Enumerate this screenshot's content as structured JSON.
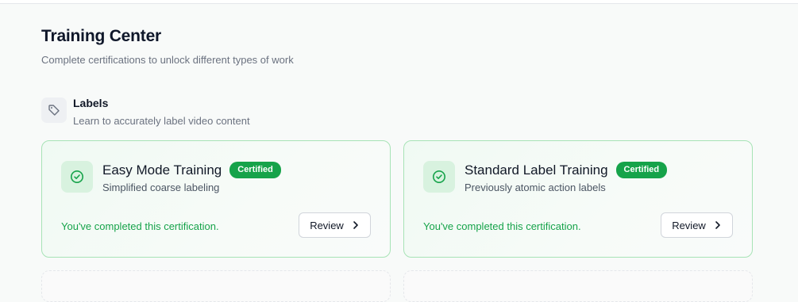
{
  "header": {
    "title": "Training Center",
    "subtitle": "Complete certifications to unlock different types of work"
  },
  "section": {
    "icon": "tag-icon",
    "title": "Labels",
    "subtitle": "Learn to accurately label video content"
  },
  "cards": [
    {
      "icon": "check-circle-icon",
      "title": "Easy Mode Training",
      "badge": "Certified",
      "subtitle": "Simplified coarse labeling",
      "status": "You've completed this certification.",
      "button_label": "Review"
    },
    {
      "icon": "check-circle-icon",
      "title": "Standard Label Training",
      "badge": "Certified",
      "subtitle": "Previously atomic action labels",
      "status": "You've completed this certification.",
      "button_label": "Review"
    }
  ],
  "colors": {
    "accent_green": "#16a34a",
    "card_border": "#a7e3b6",
    "icon_bg": "#d8f2df"
  }
}
